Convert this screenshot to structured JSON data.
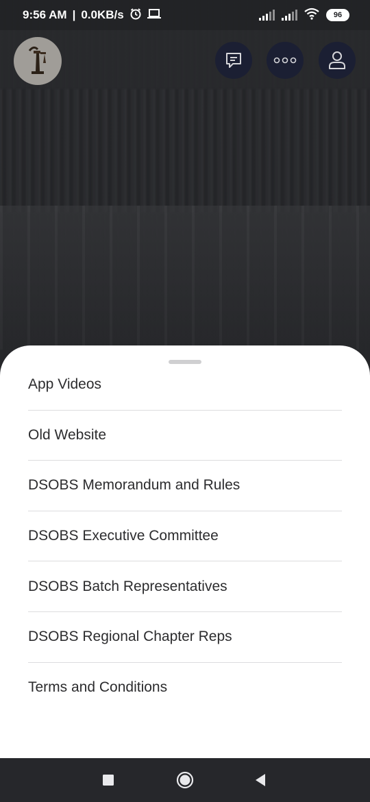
{
  "status_bar": {
    "time": "9:56 AM",
    "speed": "0.0KB/s",
    "battery": "96",
    "icons": [
      "alarm-icon",
      "laptop-icon",
      "signal-icon",
      "signal-icon",
      "wifi-icon",
      "battery-icon"
    ]
  },
  "header": {
    "logo_icon": "org-logo",
    "buttons": [
      {
        "name": "chat-icon"
      },
      {
        "name": "more-icon"
      },
      {
        "name": "profile-icon"
      }
    ]
  },
  "menu": {
    "items": [
      {
        "label": "App Videos"
      },
      {
        "label": "Old Website"
      },
      {
        "label": "DSOBS Memorandum and Rules"
      },
      {
        "label": "DSOBS Executive Committee"
      },
      {
        "label": "DSOBS Batch Representatives"
      },
      {
        "label": "DSOBS Regional Chapter Reps"
      },
      {
        "label": "Terms and Conditions"
      }
    ]
  },
  "nav_bar": {
    "buttons": [
      "recents-icon",
      "home-icon",
      "back-icon"
    ]
  },
  "colors": {
    "sheet_bg": "#ffffff",
    "header_button_bg": "#1b1f33",
    "nav_bg": "#26272b",
    "text": "#2c2c2e"
  }
}
